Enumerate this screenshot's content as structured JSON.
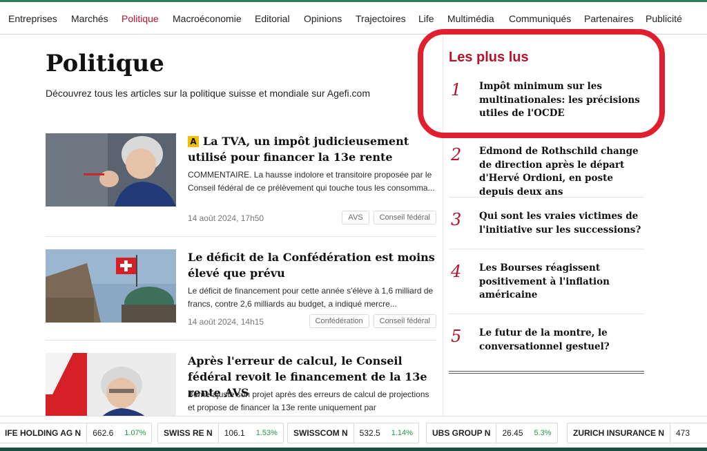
{
  "nav": {
    "items": [
      {
        "label": "Entreprises"
      },
      {
        "label": "Marchés"
      },
      {
        "label": "Politique"
      },
      {
        "label": "Macroéconomie"
      },
      {
        "label": "Editorial"
      },
      {
        "label": "Opinions"
      },
      {
        "label": "Trajectoires"
      },
      {
        "label": "Life"
      },
      {
        "label": "Multimédia"
      },
      {
        "label": "Communiqués"
      },
      {
        "label": "Partenaires"
      },
      {
        "label": "Publicité"
      }
    ],
    "active": "Politique"
  },
  "page": {
    "title": "Politique",
    "description": "Découvrez tous les articles sur la politique suisse et mondiale sur Agefi.com"
  },
  "articles": [
    {
      "premium_badge": "A",
      "title": "La TVA, un impôt judicieusement utilisé pour financer la 13e rente",
      "excerpt": "COMMENTAIRE. La hausse indolore et transitoire proposée par le Conseil fédéral de ce prélèvement qui touche tous les consomma...",
      "date": "14 août 2024, 17h50",
      "tags": [
        "AVS",
        "Conseil fédéral"
      ]
    },
    {
      "title": "Le déficit de la Confédération est moins élevé que prévu",
      "excerpt": "Le déficit de financement pour cette année s'élève à 1,6 milliard de francs, contre 2,6 milliards au budget, a indiqué mercre...",
      "date": "14 août 2024, 14h15",
      "tags": [
        "Confédération",
        "Conseil fédéral"
      ]
    },
    {
      "title": "Après l'erreur de calcul, le Conseil fédéral revoit le financement de la 13e rente AVS",
      "excerpt": "Berne ajuste son projet après des erreurs de calcul de projections et propose de financer la 13e rente uniquement par"
    }
  ],
  "popular": {
    "title": "Les plus lus",
    "items": [
      {
        "num": "1",
        "title": "Impôt minimum sur les multinationales: les précisions utiles de l'OCDE"
      },
      {
        "num": "2",
        "title": "Edmond de Rothschild change de direction après le départ d'Hervé Ordioni, en poste depuis deux ans"
      },
      {
        "num": "3",
        "title": "Qui sont les vraies victimes de l'initiative sur les successions?"
      },
      {
        "num": "4",
        "title": "Les Bourses réagissent positivement à l'inflation américaine"
      },
      {
        "num": "5",
        "title": "Le futur de la montre, le conversationnel gestuel?"
      }
    ]
  },
  "ticker": [
    {
      "name": "IFE HOLDING AG N",
      "price": "662.6",
      "change": "1.07%"
    },
    {
      "name": "SWISS RE N",
      "price": "106.1",
      "change": "1.53%"
    },
    {
      "name": "SWISSCOM N",
      "price": "532.5",
      "change": "1.14%"
    },
    {
      "name": "UBS GROUP N",
      "price": "26.45",
      "change": "5.3%"
    },
    {
      "name": "ZURICH INSURANCE N",
      "price": "473"
    }
  ],
  "colors": {
    "accent_red": "#b5122b",
    "highlight_red": "#e0202e",
    "positive_green": "#1f9d3f"
  }
}
